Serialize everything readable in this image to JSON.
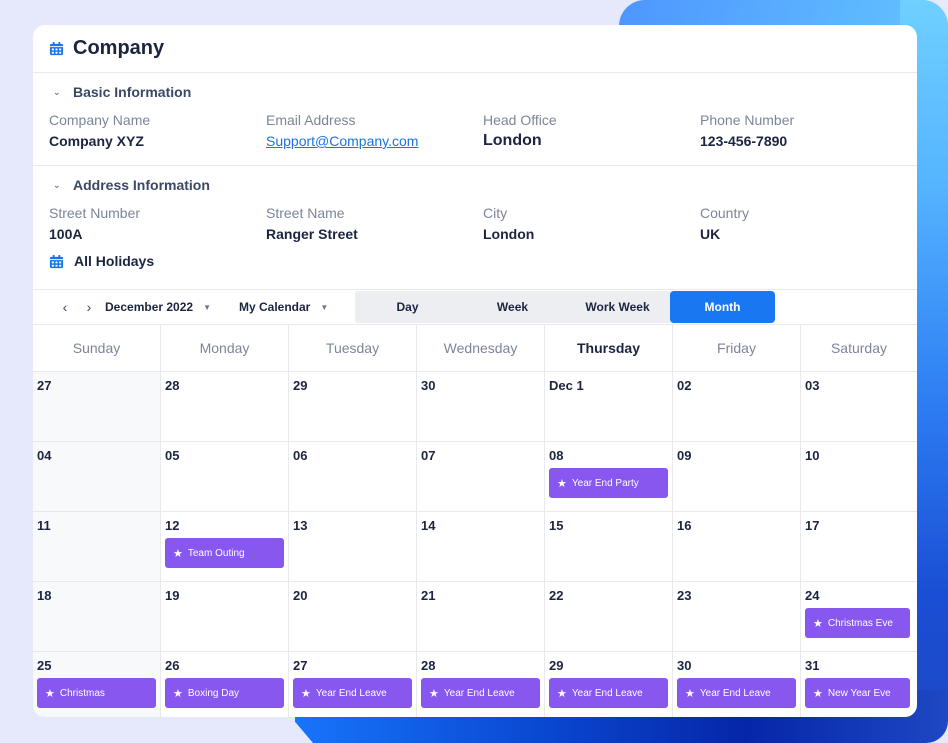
{
  "header": {
    "title": "Company",
    "icon": "calendar-icon"
  },
  "basic_info": {
    "section_label": "Basic Information",
    "fields": [
      {
        "label": "Company Name",
        "value": "Company XYZ"
      },
      {
        "label": "Email Address",
        "value": "Support@Company.com"
      },
      {
        "label": "Head Office",
        "value": "London"
      },
      {
        "label": "Phone Number",
        "value": "123-456-7890"
      }
    ]
  },
  "address_info": {
    "section_label": "Address Information",
    "fields": [
      {
        "label": "Street Number",
        "value": "100A"
      },
      {
        "label": "Street Name",
        "value": "Ranger Street"
      },
      {
        "label": "City",
        "value": "London"
      },
      {
        "label": "Country",
        "value": "UK"
      }
    ]
  },
  "holidays": {
    "title": "All Holidays",
    "toolbar": {
      "prev": "‹",
      "next": "›",
      "month_selector": "December 2022",
      "calendar_selector": "My Calendar",
      "views": [
        "Day",
        "Week",
        "Work Week",
        "Month"
      ],
      "active_view": "Month"
    },
    "weekdays": [
      "Sunday",
      "Monday",
      "Tuesday",
      "Wednesday",
      "Thursday",
      "Friday",
      "Saturday"
    ],
    "current_weekday": "Thursday",
    "weeks": [
      [
        {
          "day": "27"
        },
        {
          "day": "28"
        },
        {
          "day": "29"
        },
        {
          "day": "30"
        },
        {
          "day": "Dec 1"
        },
        {
          "day": "02"
        },
        {
          "day": "03"
        }
      ],
      [
        {
          "day": "04"
        },
        {
          "day": "05"
        },
        {
          "day": "06"
        },
        {
          "day": "07"
        },
        {
          "day": "08",
          "event": "Year End Party"
        },
        {
          "day": "09"
        },
        {
          "day": "10"
        }
      ],
      [
        {
          "day": "11"
        },
        {
          "day": "12",
          "event": "Team Outing"
        },
        {
          "day": "13"
        },
        {
          "day": "14"
        },
        {
          "day": "15"
        },
        {
          "day": "16"
        },
        {
          "day": "17"
        }
      ],
      [
        {
          "day": "18"
        },
        {
          "day": "19"
        },
        {
          "day": "20"
        },
        {
          "day": "21"
        },
        {
          "day": "22"
        },
        {
          "day": "23"
        },
        {
          "day": "24",
          "event": "Christmas Eve"
        }
      ],
      [
        {
          "day": "25",
          "event": "Christmas"
        },
        {
          "day": "26",
          "event": "Boxing Day"
        },
        {
          "day": "27",
          "event": "Year End Leave"
        },
        {
          "day": "28",
          "event": "Year End Leave"
        },
        {
          "day": "29",
          "event": "Year End Leave"
        },
        {
          "day": "30",
          "event": "Year End Leave"
        },
        {
          "day": "31",
          "event": "New Year Eve"
        }
      ]
    ],
    "event_color": "#8757ef",
    "accent_color": "#1a77f2"
  }
}
